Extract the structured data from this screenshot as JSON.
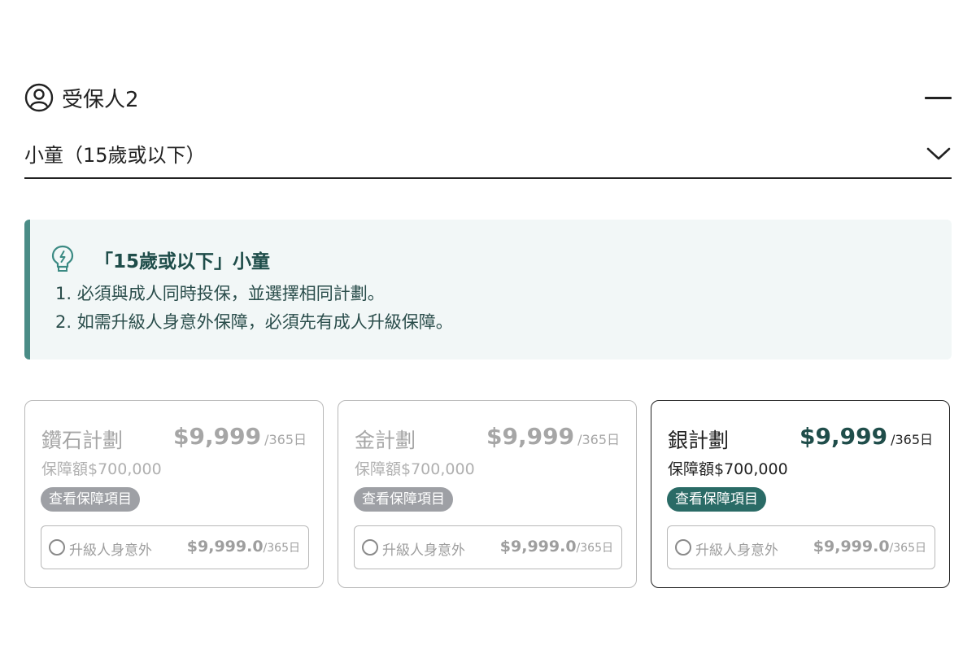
{
  "insured": {
    "label": "受保人2",
    "icon": "person-circle-icon",
    "collapse_icon": "minus-icon"
  },
  "age_select": {
    "selected": "小童（15歲或以下）",
    "icon": "chevron-down-icon"
  },
  "notice": {
    "icon": "lightbulb-icon",
    "title": "「15歲或以下」小童",
    "items": [
      "1. 必須與成人同時投保，並選擇相同計劃。",
      "2. 如需升級人身意外保障，必須先有成人升級保障。"
    ]
  },
  "plans": [
    {
      "name": "鑽石計劃",
      "price": "$9,999",
      "period": "/365日",
      "coverage": "保障額$700,000",
      "details_button": "查看保障項目",
      "upgrade_label": "升級人身意外",
      "upgrade_price": "$9,999.0",
      "upgrade_period": "/365日",
      "selected": false
    },
    {
      "name": "金計劃",
      "price": "$9,999",
      "period": "/365日",
      "coverage": "保障額$700,000",
      "details_button": "查看保障項目",
      "upgrade_label": "升級人身意外",
      "upgrade_price": "$9,999.0",
      "upgrade_period": "/365日",
      "selected": false
    },
    {
      "name": "銀計劃",
      "price": "$9,999",
      "period": "/365日",
      "coverage": "保障額$700,000",
      "details_button": "查看保障項目",
      "upgrade_label": "升級人身意外",
      "upgrade_price": "$9,999.0",
      "upgrade_period": "/365日",
      "selected": true
    }
  ],
  "colors": {
    "accent": "#2a6b66",
    "notice_background": "#f2f7f7",
    "notice_bar": "#4a8c86",
    "disabled_text": "#a6a6a6"
  }
}
